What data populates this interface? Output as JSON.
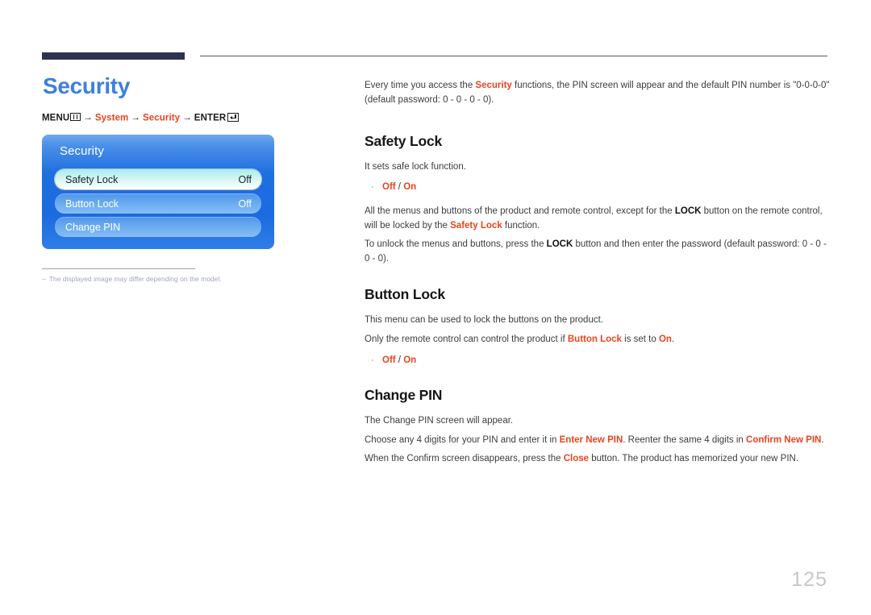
{
  "page": {
    "title": "Security",
    "number": "125"
  },
  "breadcrumb": {
    "menu_label": "MENU",
    "menu_icon": "menu-grid-icon",
    "arrow": "→",
    "step_system": "System",
    "step_security": "Security",
    "enter_label": "ENTER",
    "enter_icon": "enter-return-icon"
  },
  "osd": {
    "title": "Security",
    "rows": [
      {
        "label": "Safety Lock",
        "value": "Off",
        "selected": true
      },
      {
        "label": "Button Lock",
        "value": "Off",
        "selected": false
      },
      {
        "label": "Change PIN",
        "value": "",
        "selected": false
      }
    ]
  },
  "footnote": {
    "dash": "–",
    "text": "The displayed image may differ depending on the model."
  },
  "intro": {
    "part1": "Every time you access the ",
    "highlight": "Security",
    "part2": " functions, the PIN screen will appear and the default PIN number is \"0-0-0-0\" (default password: 0 - 0 - 0 - 0)."
  },
  "sections": [
    {
      "heading": "Safety Lock",
      "paragraphs": [
        {
          "p1": "It sets safe lock function."
        }
      ],
      "bullet": {
        "off": "Off",
        "slash": " / ",
        "on": "On"
      },
      "after": [
        {
          "a1": "All the menus and buttons of the product and remote control, except for the ",
          "b1": "LOCK",
          "a2": " button on the remote control, will be locked by the ",
          "r1": "Safety Lock",
          "a3": " function."
        },
        {
          "a1": "To unlock the menus and buttons, press the ",
          "b1": "LOCK",
          "a2": " button and then enter the password (default password: 0 - 0 - 0 - 0)."
        }
      ]
    },
    {
      "heading": "Button Lock",
      "paragraphs": [
        {
          "p1": "This menu can be used to lock the buttons on the product."
        }
      ],
      "line2": {
        "a1": "Only the remote control can control the product if ",
        "r1": "Button Lock",
        "a2": " is set to ",
        "r2": "On",
        "a3": "."
      },
      "bullet": {
        "off": "Off",
        "slash": " / ",
        "on": "On"
      }
    },
    {
      "heading": "Change PIN",
      "paragraphs": [
        {
          "p1": "The Change PIN screen will appear."
        }
      ],
      "line2": {
        "a1": "Choose any 4 digits for your PIN and enter it in ",
        "r1": "Enter New PIN",
        "a2": ". Reenter the same 4 digits in ",
        "r2": "Confirm New PIN",
        "a3": "."
      },
      "line3": {
        "a1": "When the Confirm screen disappears, press the ",
        "r1": "Close",
        "a2": " button. The product has memorized your new PIN."
      }
    }
  ],
  "colors": {
    "accent_blue": "#3d7fe0",
    "accent_red": "#e8441f",
    "rule_navy": "#2e3152",
    "osd_blue": "#1f6fe0",
    "page_number_gray": "#c7c7c7"
  }
}
